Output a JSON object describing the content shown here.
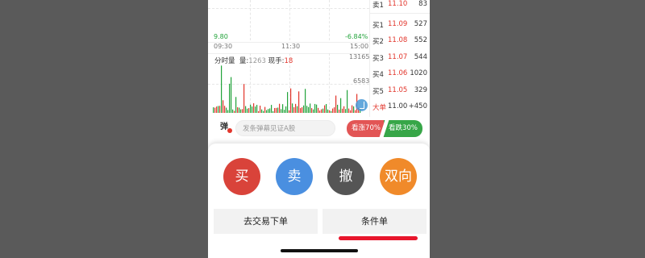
{
  "chart": {
    "left_price": "9.80",
    "change_pct": "-6.84%",
    "times": [
      "09:30",
      "11:30",
      "15:00"
    ],
    "volume_label": "分时量",
    "vol_label": "量:",
    "vol_value": "1263",
    "current_label": "现手:",
    "current_value": "18",
    "vol_axis_top": "13165",
    "vol_axis_mid": "6583"
  },
  "order_book": [
    {
      "label": "卖1",
      "price": "11.10",
      "volume": "83"
    },
    {
      "label": "买1",
      "price": "11.09",
      "volume": "527"
    },
    {
      "label": "买2",
      "price": "11.08",
      "volume": "552"
    },
    {
      "label": "买3",
      "price": "11.07",
      "volume": "544"
    },
    {
      "label": "买4",
      "price": "11.06",
      "volume": "1020"
    },
    {
      "label": "买5",
      "price": "11.05",
      "volume": "329"
    },
    {
      "label": "大单",
      "price": "11.00",
      "volume": "+450"
    }
  ],
  "danmu": {
    "icon_char": "弹",
    "placeholder": "发条弹幕见证A股",
    "bullish": "看涨70%",
    "bearish": "看跌30%",
    "bullish_ratio": 0.7
  },
  "actions": {
    "buy": "买",
    "sell": "卖",
    "cancel": "撤",
    "dual": "双向",
    "go_trade": "去交易下单",
    "condition_order": "条件单"
  },
  "colors": {
    "buy": "#d9433a",
    "sell": "#4a8fe0",
    "cancel": "#555555",
    "dual": "#f08a2a",
    "up": "#e2352b",
    "down": "#22a33a"
  }
}
